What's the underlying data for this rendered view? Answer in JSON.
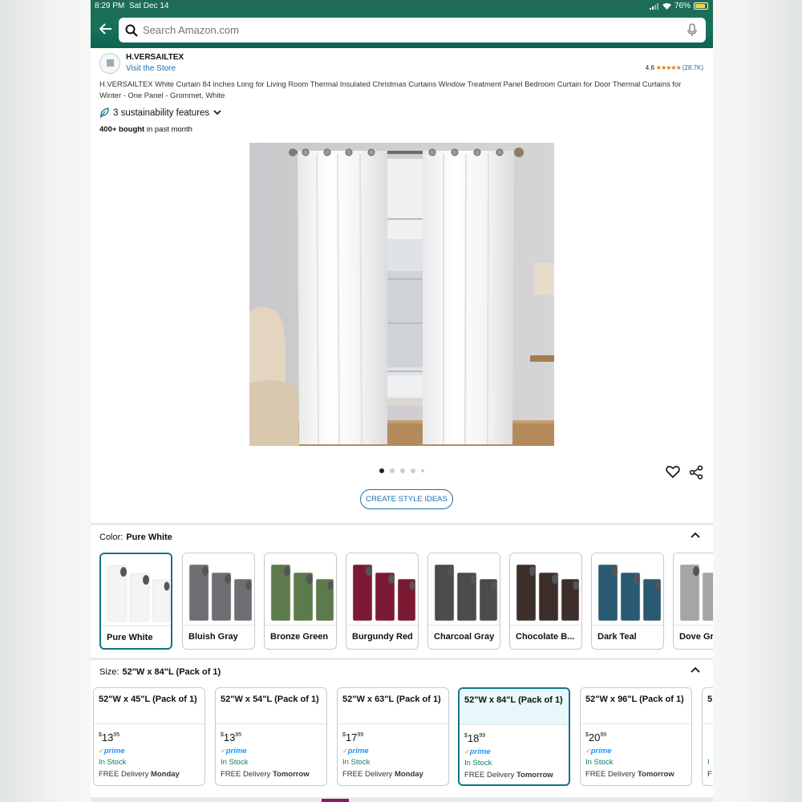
{
  "status_bar": {
    "time": "8:29 PM",
    "date": "Sat Dec 14",
    "battery": "76%"
  },
  "search": {
    "placeholder": "Search Amazon.com"
  },
  "store": {
    "name": "H.VERSAILTEX",
    "visit_label": "Visit the Store"
  },
  "rating": {
    "value": "4.6",
    "stars": "★★★★★",
    "count": "(28.7K)"
  },
  "product": {
    "title": "H.VERSAILTEX White Curtain 84 inches Long for Living Room Thermal Insulated Christmas Curtains Window Treatment Panel Bedroom Curtain for Door Thermal Curtains for Winter - One Panel - Grommet, White",
    "sustainability": "3 sustainability features",
    "bought_bold": "400+ bought",
    "bought_rest": " in past month"
  },
  "gallery": {
    "image_count": 5,
    "active_index": 0
  },
  "style_button": "CREATE STYLE IDEAS",
  "color": {
    "label": "Color:",
    "selected": "Pure White",
    "options": [
      {
        "name": "Pure White",
        "hex": "#f4f4f4",
        "selected": true
      },
      {
        "name": "Bluish Gray",
        "hex": "#6d6f72"
      },
      {
        "name": "Bronze Green",
        "hex": "#5d7a4d"
      },
      {
        "name": "Burgundy Red",
        "hex": "#7c1a33"
      },
      {
        "name": "Charcoal Gray",
        "hex": "#4b4b4d"
      },
      {
        "name": "Chocolate B...",
        "hex": "#3e2e2a"
      },
      {
        "name": "Dark Teal",
        "hex": "#2a5a72"
      },
      {
        "name": "Dove Gr",
        "hex": "#a4a5a6"
      }
    ]
  },
  "size": {
    "label": "Size:",
    "selected": "52\"W x 84\"L (Pack of 1)",
    "options": [
      {
        "name": "52\"W x 45\"L (Pack of 1)",
        "dollars": "13",
        "cents": "95",
        "currency": "$",
        "prime": "prime",
        "stock": "In Stock",
        "delivery_prefix": "FREE Delivery",
        "delivery_day": "Monday"
      },
      {
        "name": "52\"W x 54\"L (Pack of 1)",
        "dollars": "13",
        "cents": "95",
        "currency": "$",
        "prime": "prime",
        "stock": "In Stock",
        "delivery_prefix": "FREE Delivery",
        "delivery_day": "Tomorrow"
      },
      {
        "name": "52\"W x 63\"L (Pack of 1)",
        "dollars": "17",
        "cents": "99",
        "currency": "$",
        "prime": "prime",
        "stock": "In Stock",
        "delivery_prefix": "FREE Delivery",
        "delivery_day": "Monday"
      },
      {
        "name": "52\"W x 84\"L (Pack of 1)",
        "dollars": "18",
        "cents": "99",
        "currency": "$",
        "prime": "prime",
        "stock": "In Stock",
        "delivery_prefix": "FREE Delivery",
        "delivery_day": "Tomorrow",
        "selected": true
      },
      {
        "name": "52\"W x 96\"L (Pack of 1)",
        "dollars": "20",
        "cents": "99",
        "currency": "$",
        "prime": "prime",
        "stock": "In Stock",
        "delivery_prefix": "FREE Delivery",
        "delivery_day": "Tomorrow"
      },
      {
        "name": "5",
        "dollars": "",
        "cents": "",
        "currency": "$",
        "prime": "",
        "stock": "I",
        "delivery_prefix": "F",
        "delivery_day": ""
      }
    ]
  },
  "colors": {
    "brand_green": "#167258",
    "link": "#1a6fb0",
    "selected_border": "#127486",
    "in_stock": "#067d62"
  }
}
